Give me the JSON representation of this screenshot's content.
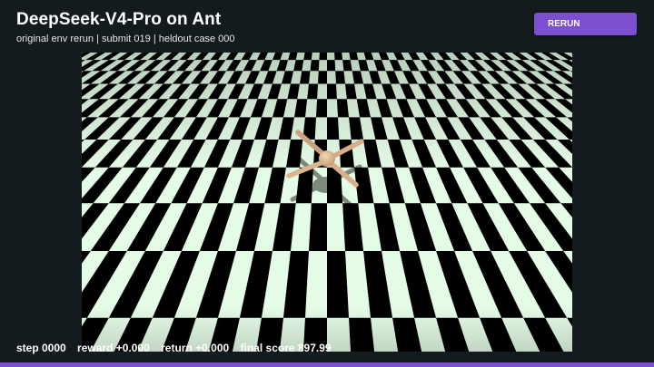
{
  "header": {
    "title": "DeepSeek-V4-Pro on Ant",
    "subtitle": "original env rerun | submit 019 | heldout case 000"
  },
  "controls": {
    "rerun_label": "RERUN"
  },
  "status": {
    "step": "step 0000",
    "reward": "reward +0.000",
    "return": "return +0.000",
    "final_score": "final score 897.99"
  },
  "colors": {
    "accent": "#7b4fd0",
    "background": "#131b1e",
    "floor_light": "#e4fbe6",
    "floor_dark": "#000000",
    "agent_body": "#dfb790"
  }
}
